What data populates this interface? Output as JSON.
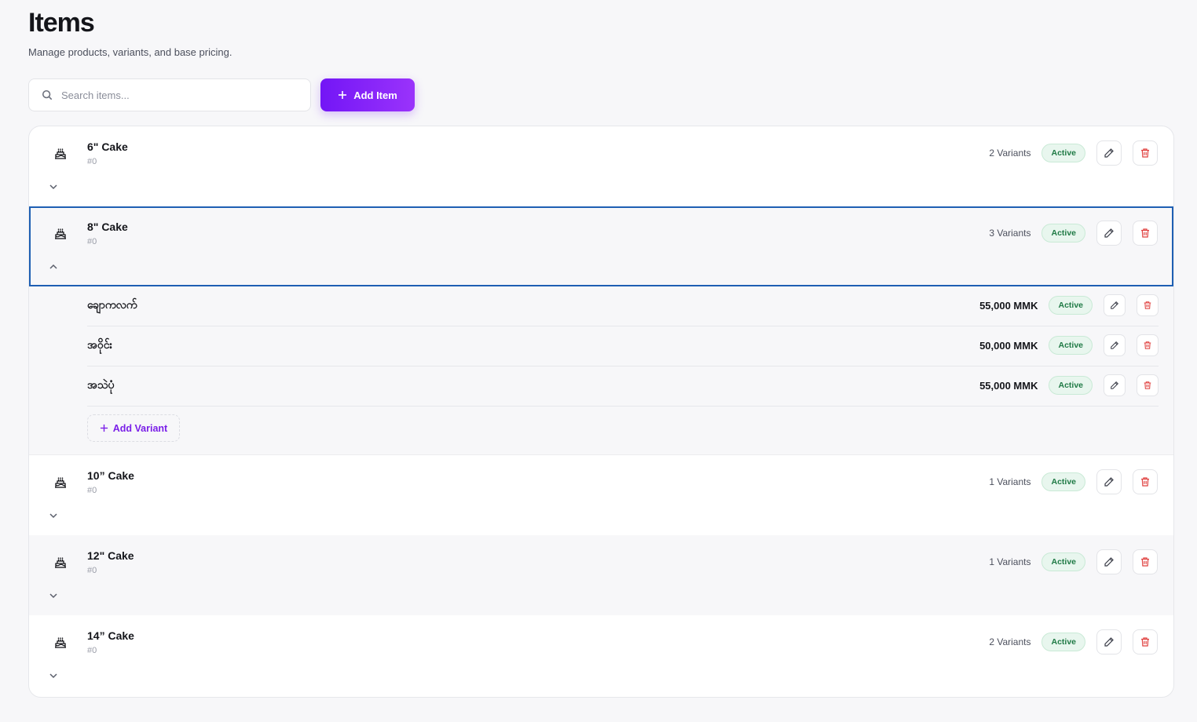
{
  "header": {
    "title": "Items",
    "subtitle": "Manage products, variants, and base pricing."
  },
  "toolbar": {
    "search_placeholder": "Search items...",
    "search_value": "",
    "add_item_label": "Add Item"
  },
  "status_label": "Active",
  "add_variant_label": "Add Variant",
  "colors": {
    "accent": "#7316f6",
    "selected_border": "#1e5fb3",
    "active_badge_bg": "#e8f6ee",
    "active_badge_text": "#1f7a45",
    "delete_icon": "#e0403f"
  },
  "items": [
    {
      "name": "6\" Cake",
      "code": "#0",
      "variants_label": "2 Variants",
      "status": "Active",
      "expanded": false
    },
    {
      "name": "8\" Cake",
      "code": "#0",
      "variants_label": "3 Variants",
      "status": "Active",
      "expanded": true,
      "variants": [
        {
          "name": "ချောကလက်",
          "price": "55,000 MMK",
          "status": "Active"
        },
        {
          "name": "အဝိုင်း",
          "price": "50,000 MMK",
          "status": "Active"
        },
        {
          "name": "အသဲပုံ",
          "price": "55,000 MMK",
          "status": "Active"
        }
      ]
    },
    {
      "name": "10” Cake",
      "code": "#0",
      "variants_label": "1 Variants",
      "status": "Active",
      "expanded": false
    },
    {
      "name": "12\" Cake",
      "code": "#0",
      "variants_label": "1 Variants",
      "status": "Active",
      "expanded": false
    },
    {
      "name": "14” Cake",
      "code": "#0",
      "variants_label": "2 Variants",
      "status": "Active",
      "expanded": false
    }
  ]
}
